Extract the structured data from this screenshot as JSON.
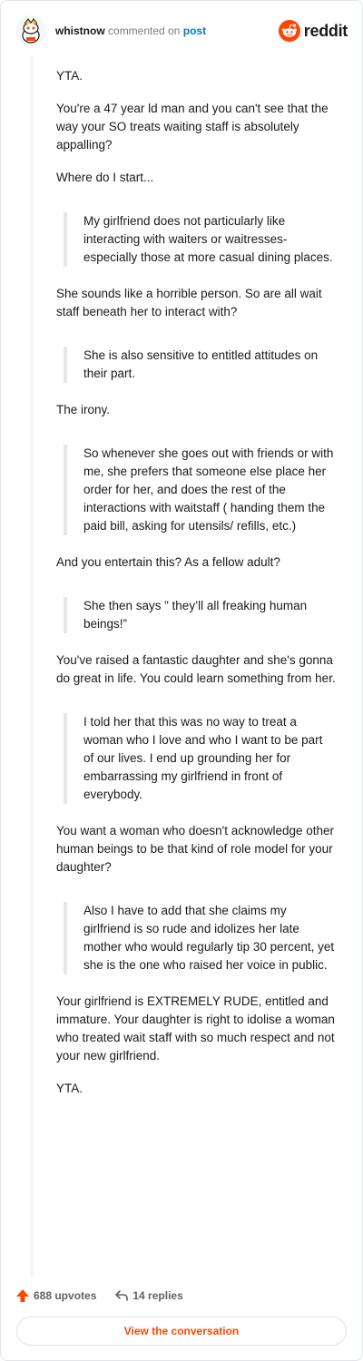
{
  "header": {
    "username": "whistnow",
    "commented_on": "commented on",
    "post_link": "post",
    "brand": "reddit"
  },
  "comment": {
    "paragraphs": [
      "YTA.",
      "You're a 47 year ld man and you can't see that the way your SO treats waiting staff is absolutely appalling?",
      "Where do I start...",
      "She sounds like a horrible person. So are all wait staff beneath her to interact with?",
      "The irony.",
      "And you entertain this? As a fellow adult?",
      "You've raised a fantastic daughter and she's gonna do great in life. You could learn something from her.",
      "You want a woman who doesn't acknowledge other human beings to be that kind of role model for your daughter?",
      "Your girlfriend is EXTREMELY RUDE, entitled and immature. Your daughter is right to idolise a woman who treated wait staff with so much respect and not your new girlfriend.",
      "YTA."
    ],
    "quotes": [
      "My girlfriend does not particularly like interacting with waiters or waitresses- especially those at more casual dining places.",
      "She is also sensitive to entitled attitudes on their part.",
      "So whenever she goes out with friends or with me, she prefers that someone else place her order for her, and does the rest of the interactions with waitstaff ( handing them the paid bill, asking for utensils/ refills, etc.)",
      "She then says ” they’ll all freaking human beings!”",
      "I told her that this was no way to treat a woman who I love and who I want to be part of our lives. I end up grounding her for embarrassing my girlfriend in front of everybody.",
      "Also I have to add that she claims my girlfriend is so rude and idolizes her late mother who would regularly tip 30 percent, yet she is the one who raised her voice in public."
    ]
  },
  "footer": {
    "upvotes": "688 upvotes",
    "replies": "14 replies",
    "view_conversation": "View the conversation"
  },
  "colors": {
    "brand_orange": "#ff4500",
    "link_blue": "#0079d3",
    "quote_bar": "#e4e6e8"
  },
  "icons": [
    "snoo-avatar-icon",
    "reddit-logo-icon",
    "upvote-arrow-icon",
    "reply-arrow-icon"
  ]
}
